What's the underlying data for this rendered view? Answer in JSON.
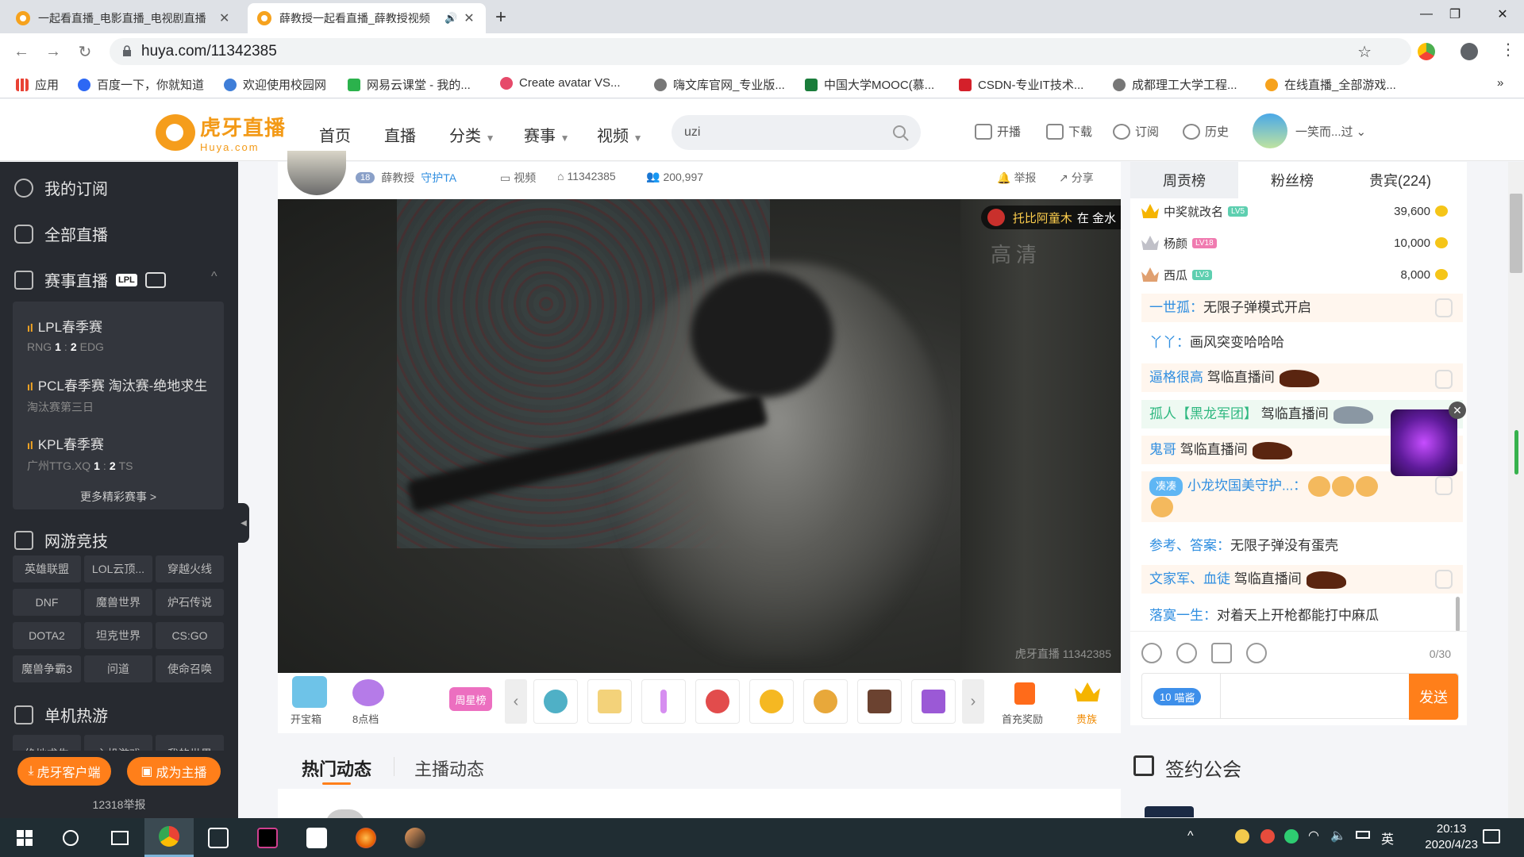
{
  "browser": {
    "tabs": [
      {
        "title": "一起看直播_电影直播_电视剧直播",
        "active": false
      },
      {
        "title": "薛教授一起看直播_薛教授视频",
        "active": true
      }
    ],
    "url": "huya.com/11342385",
    "bookmarks": [
      "应用",
      "百度一下，你就知道",
      "欢迎使用校园网",
      "网易云课堂 - 我的...",
      "Create avatar VS...",
      "嗨文库官网_专业版...",
      "中国大学MOOC(慕...",
      "CSDN-专业IT技术...",
      "成都理工大学工程...",
      "在线直播_全部游戏..."
    ],
    "more": "»"
  },
  "site": {
    "logo_cn": "虎牙直播",
    "logo_en": "Huya.com",
    "nav": [
      "首页",
      "直播",
      "分类",
      "赛事",
      "视频"
    ],
    "search_value": "uzi",
    "actions": [
      "开播",
      "下载",
      "订阅",
      "历史"
    ],
    "user": "一笑而...过"
  },
  "sidebar": {
    "items": [
      "我的订阅",
      "全部直播",
      "赛事直播"
    ],
    "lpl_badge": "LPL",
    "matches": [
      {
        "name": "LPL春季赛",
        "team1": "RNG",
        "s1": "1",
        "s2": "2",
        "team2": "EDG"
      },
      {
        "name": "PCL春季赛 淘汰赛-绝地求生",
        "sub": "淘汰赛第三日"
      },
      {
        "name": "KPL春季赛",
        "team1": "广州TTG.XQ",
        "s1": "1",
        "s2": "2",
        "team2": "TS"
      }
    ],
    "more_matches": "更多精彩赛事 >",
    "section_online": "网游竞技",
    "online_games": [
      "英雄联盟",
      "LOL云顶...",
      "穿越火线",
      "DNF",
      "魔兽世界",
      "炉石传说",
      "DOTA2",
      "坦克世界",
      "CS:GO",
      "魔兽争霸3",
      "问道",
      "使命召唤"
    ],
    "section_single": "单机热游",
    "single_games": [
      "绝地求生",
      "主机游戏",
      "我的世界"
    ],
    "client_btn": "虎牙客户端",
    "anchor_btn": "成为主播",
    "report": "12318举报"
  },
  "stream": {
    "streamer": "薛教授",
    "level": "18",
    "guard": "守护TA",
    "video_label": "视频",
    "room_id": "11342385",
    "viewers": "200,997",
    "report": "举报",
    "share": "分享",
    "banner_name": "托比阿童木",
    "banner_text": "在 金水",
    "quality": "高清",
    "watermark": "虎牙直播 11342385"
  },
  "giftbar": {
    "treasure": "开宝箱",
    "points": "8点档",
    "weekly": "周星榜",
    "first_recharge": "首充奖励",
    "noble": "贵族"
  },
  "dynamics": {
    "tab_hot": "热门动态",
    "tab_anchor": "主播动态"
  },
  "rightpanel": {
    "tabs": [
      "周贡榜",
      "粉丝榜",
      "贵宾(224)"
    ],
    "ranks": [
      {
        "name": "中奖就改名",
        "lv": "LV5",
        "value": "39,600",
        "color": "#f5b400"
      },
      {
        "name": "杨颜",
        "lv": "LV18",
        "value": "10,000",
        "color": "#c0c0c8"
      },
      {
        "name": "西瓜",
        "lv": "LV3",
        "value": "8,000",
        "color": "#e0a070"
      }
    ],
    "chat": [
      {
        "user": "一世孤：",
        "text": "无限子弹模式开启"
      },
      {
        "user": "丫丫：",
        "text": "画风突变哈哈哈"
      },
      {
        "user": "逼格很高",
        "text": "驾临直播间"
      },
      {
        "user": "孤人【黑龙军团】",
        "text": "驾临直播间"
      },
      {
        "user": "鬼哥",
        "text": "驾临直播间"
      },
      {
        "user": "小龙坎国美守护...：",
        "text": "",
        "badge": "凑凑"
      },
      {
        "user": "参考、答案：",
        "text": "无限子弹没有蛋壳"
      },
      {
        "user": "文家军、血徒",
        "text": "驾临直播间"
      },
      {
        "user": "落寞一生：",
        "text": "对着天上开枪都能打中麻瓜"
      }
    ],
    "char_count": "0/30",
    "lianmai": "喵酱",
    "send": "发送"
  },
  "guild": {
    "title": "签约公会"
  },
  "taskbar": {
    "time": "20:13",
    "date": "2020/4/23",
    "ime": "英"
  }
}
